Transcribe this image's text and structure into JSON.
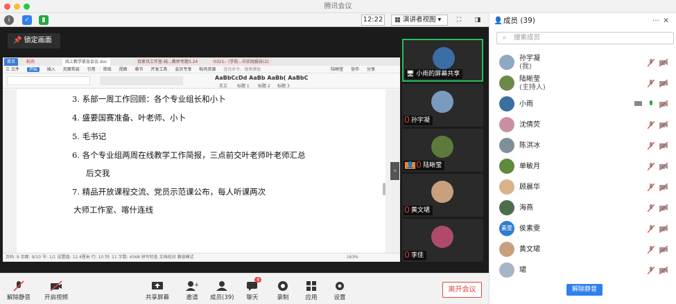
{
  "app": {
    "title": "腾讯会议"
  },
  "topbar": {
    "time": "12:22",
    "view_mode": "演讲者视图"
  },
  "lock_label": "锁定画面",
  "doc": {
    "tabs": [
      "首页",
      "稻壳",
      "线上教学紧急会议.doc",
      "百家讯工作室-线...教师专题3.24",
      "0321-（学前...中实践报告(2)"
    ],
    "menu": [
      "三 文件",
      "开始",
      "插入",
      "页面布局",
      "引用",
      "审阅",
      "视图",
      "章节",
      "开发工具",
      "会员专享",
      "稻壳资源",
      "查找命令、搜索模板",
      "陆晰莹",
      "协作",
      "分享"
    ],
    "styles": [
      "正文",
      "标题 1",
      "标题 2",
      "标题 3"
    ],
    "lines": [
      "3.  系部一周工作回顾：各个专业组长和小卜",
      "4.  盛要国赛准备、叶老师、小卜",
      "5.  毛书记",
      "6.  各个专业组两周在线教学工作简报，三点前交叶老师叶老师汇总",
      "后交我",
      "7.  精品开放课程交流、党员示范课公布，每人听课两次",
      "大师工作室、喀什连线"
    ],
    "status": "页码: 9    页面: 9/10    节: 1/1    设置值: 12.4厘米    行: 10    列: 11    字数: 4568    拼写检查    文档校对    兼容模式",
    "zoom": "163%"
  },
  "thumbnails": [
    {
      "name": "小雨的屏幕共享",
      "color": "#3a6ea5"
    },
    {
      "name": "孙宇凝",
      "color": "#7a9abf"
    },
    {
      "name": "陆晰莹",
      "color": "#5d7a3c"
    },
    {
      "name": "黄文珺",
      "color": "#c9a07c"
    },
    {
      "name": "李佳",
      "color": "#b04a6a"
    }
  ],
  "toolbar": {
    "mute": "解除静音",
    "video": "开启视频",
    "share": "共享屏幕",
    "invite": "邀请",
    "members": "成员(39)",
    "chat": "聊天",
    "chat_badge": "4",
    "record": "录制",
    "apps": "应用",
    "settings": "设置",
    "leave": "离开会议"
  },
  "panel": {
    "title": "成员 (39)",
    "search_placeholder": "搜索成员",
    "unmute_all": "解除静音",
    "members": [
      {
        "name": "孙宇凝",
        "sub": "(我)",
        "color": "#8fa8c4"
      },
      {
        "name": "陆晰莹",
        "sub": "(主持人)",
        "color": "#6b8a4a"
      },
      {
        "name": "小雨",
        "sub": "",
        "color": "#3b6fa0"
      },
      {
        "name": "沈倩荧",
        "sub": "",
        "color": "#c98fa0"
      },
      {
        "name": "陈洪冰",
        "sub": "",
        "color": "#7d8f99"
      },
      {
        "name": "单敏月",
        "sub": "",
        "color": "#5e8a3a"
      },
      {
        "name": "顾晨华",
        "sub": "",
        "color": "#d6b38a"
      },
      {
        "name": "海燕",
        "sub": "",
        "color": "#4d6e4d"
      },
      {
        "name": "侯素雯",
        "sub": "",
        "color": "#2e7dd1",
        "initials": "素雯"
      },
      {
        "name": "黄文珺",
        "sub": "",
        "color": "#c9a07c"
      },
      {
        "name": "珺",
        "sub": "",
        "color": "#a7b5c9"
      }
    ]
  },
  "colors": {
    "accent": "#2f80ed",
    "danger": "#e14545",
    "active_border": "#25c25a"
  }
}
